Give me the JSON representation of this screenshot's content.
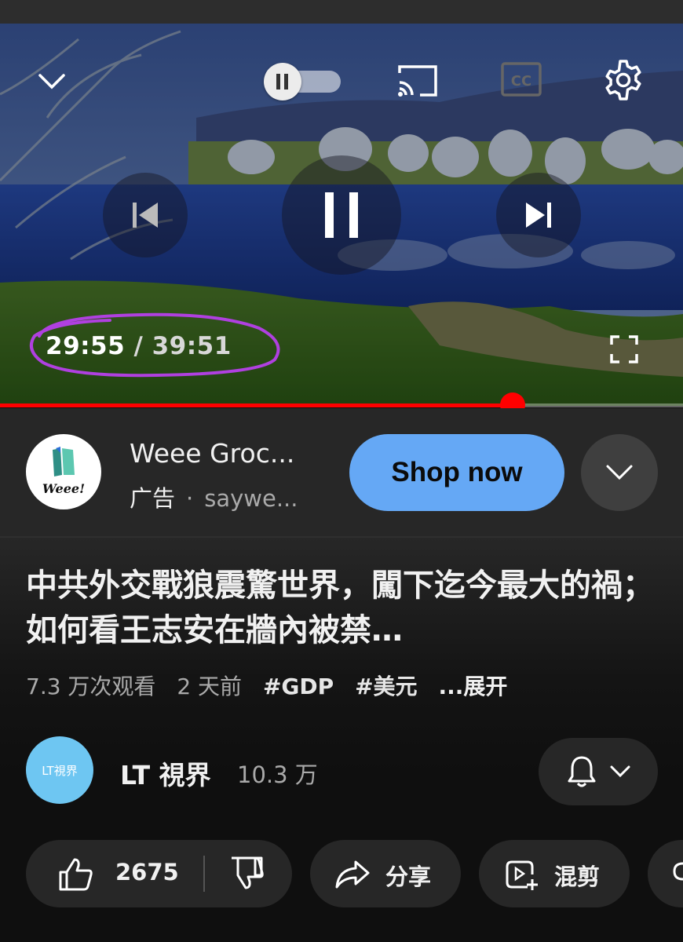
{
  "player": {
    "current_time": "29:55",
    "separator": "/",
    "duration": "39:51",
    "progress_fraction": 0.751,
    "autoplay_on": false
  },
  "ad": {
    "advertiser": "Weee Groc...",
    "logo_text": "Weee!",
    "label": "广告",
    "separator": "·",
    "domain": "saywe...",
    "cta": "Shop now"
  },
  "video": {
    "title": "中共外交戰狼震驚世界，闖下迄今最大的禍；如何看王志安在牆內被禁…",
    "views": "7.3 万次观看",
    "age": "2 天前",
    "hashtags": [
      "#GDP",
      "#美元"
    ],
    "more": "...展开"
  },
  "channel": {
    "avatar_text": "LT視界",
    "name": "LT 視界",
    "subscribers": "10.3 万"
  },
  "actions": {
    "likes": "2675",
    "share": "分享",
    "remix": "混剪"
  },
  "colors": {
    "accent_red": "#ff0000",
    "cta_blue": "#65a8f5",
    "annotation_purple": "#b040e0"
  }
}
